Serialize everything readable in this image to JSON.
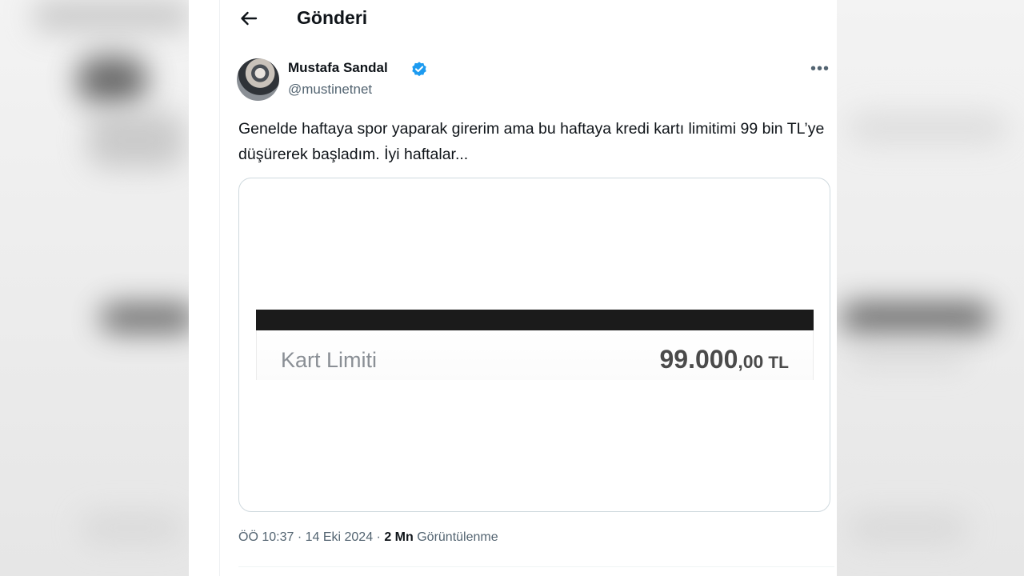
{
  "header": {
    "title": "Gönderi"
  },
  "post": {
    "author_name": "Mustafa Sandal",
    "handle": "@mustinetnet",
    "text": "Genelde haftaya spor yaparak girerim ama bu haftaya kredi kartı limitimi 99 bin TL’ye düşürerek başladım. İyi haftalar...",
    "meta": {
      "time": "ÖÖ 10:37",
      "separator1": " · ",
      "date": "14 Eki 2024",
      "separator2": " · ",
      "views_count": "2 Mn",
      "views_label": " Görüntülenme"
    }
  },
  "media": {
    "label": "Kart Limiti",
    "value_main": "99.000",
    "value_cents": ",00",
    "currency": "TL"
  },
  "icons": {
    "back": "back-arrow-icon",
    "verified": "verified-badge-icon",
    "more": "more-options-icon"
  },
  "colors": {
    "verified": "#1d9bf0",
    "text": "#0f1419",
    "secondary": "#536471"
  }
}
